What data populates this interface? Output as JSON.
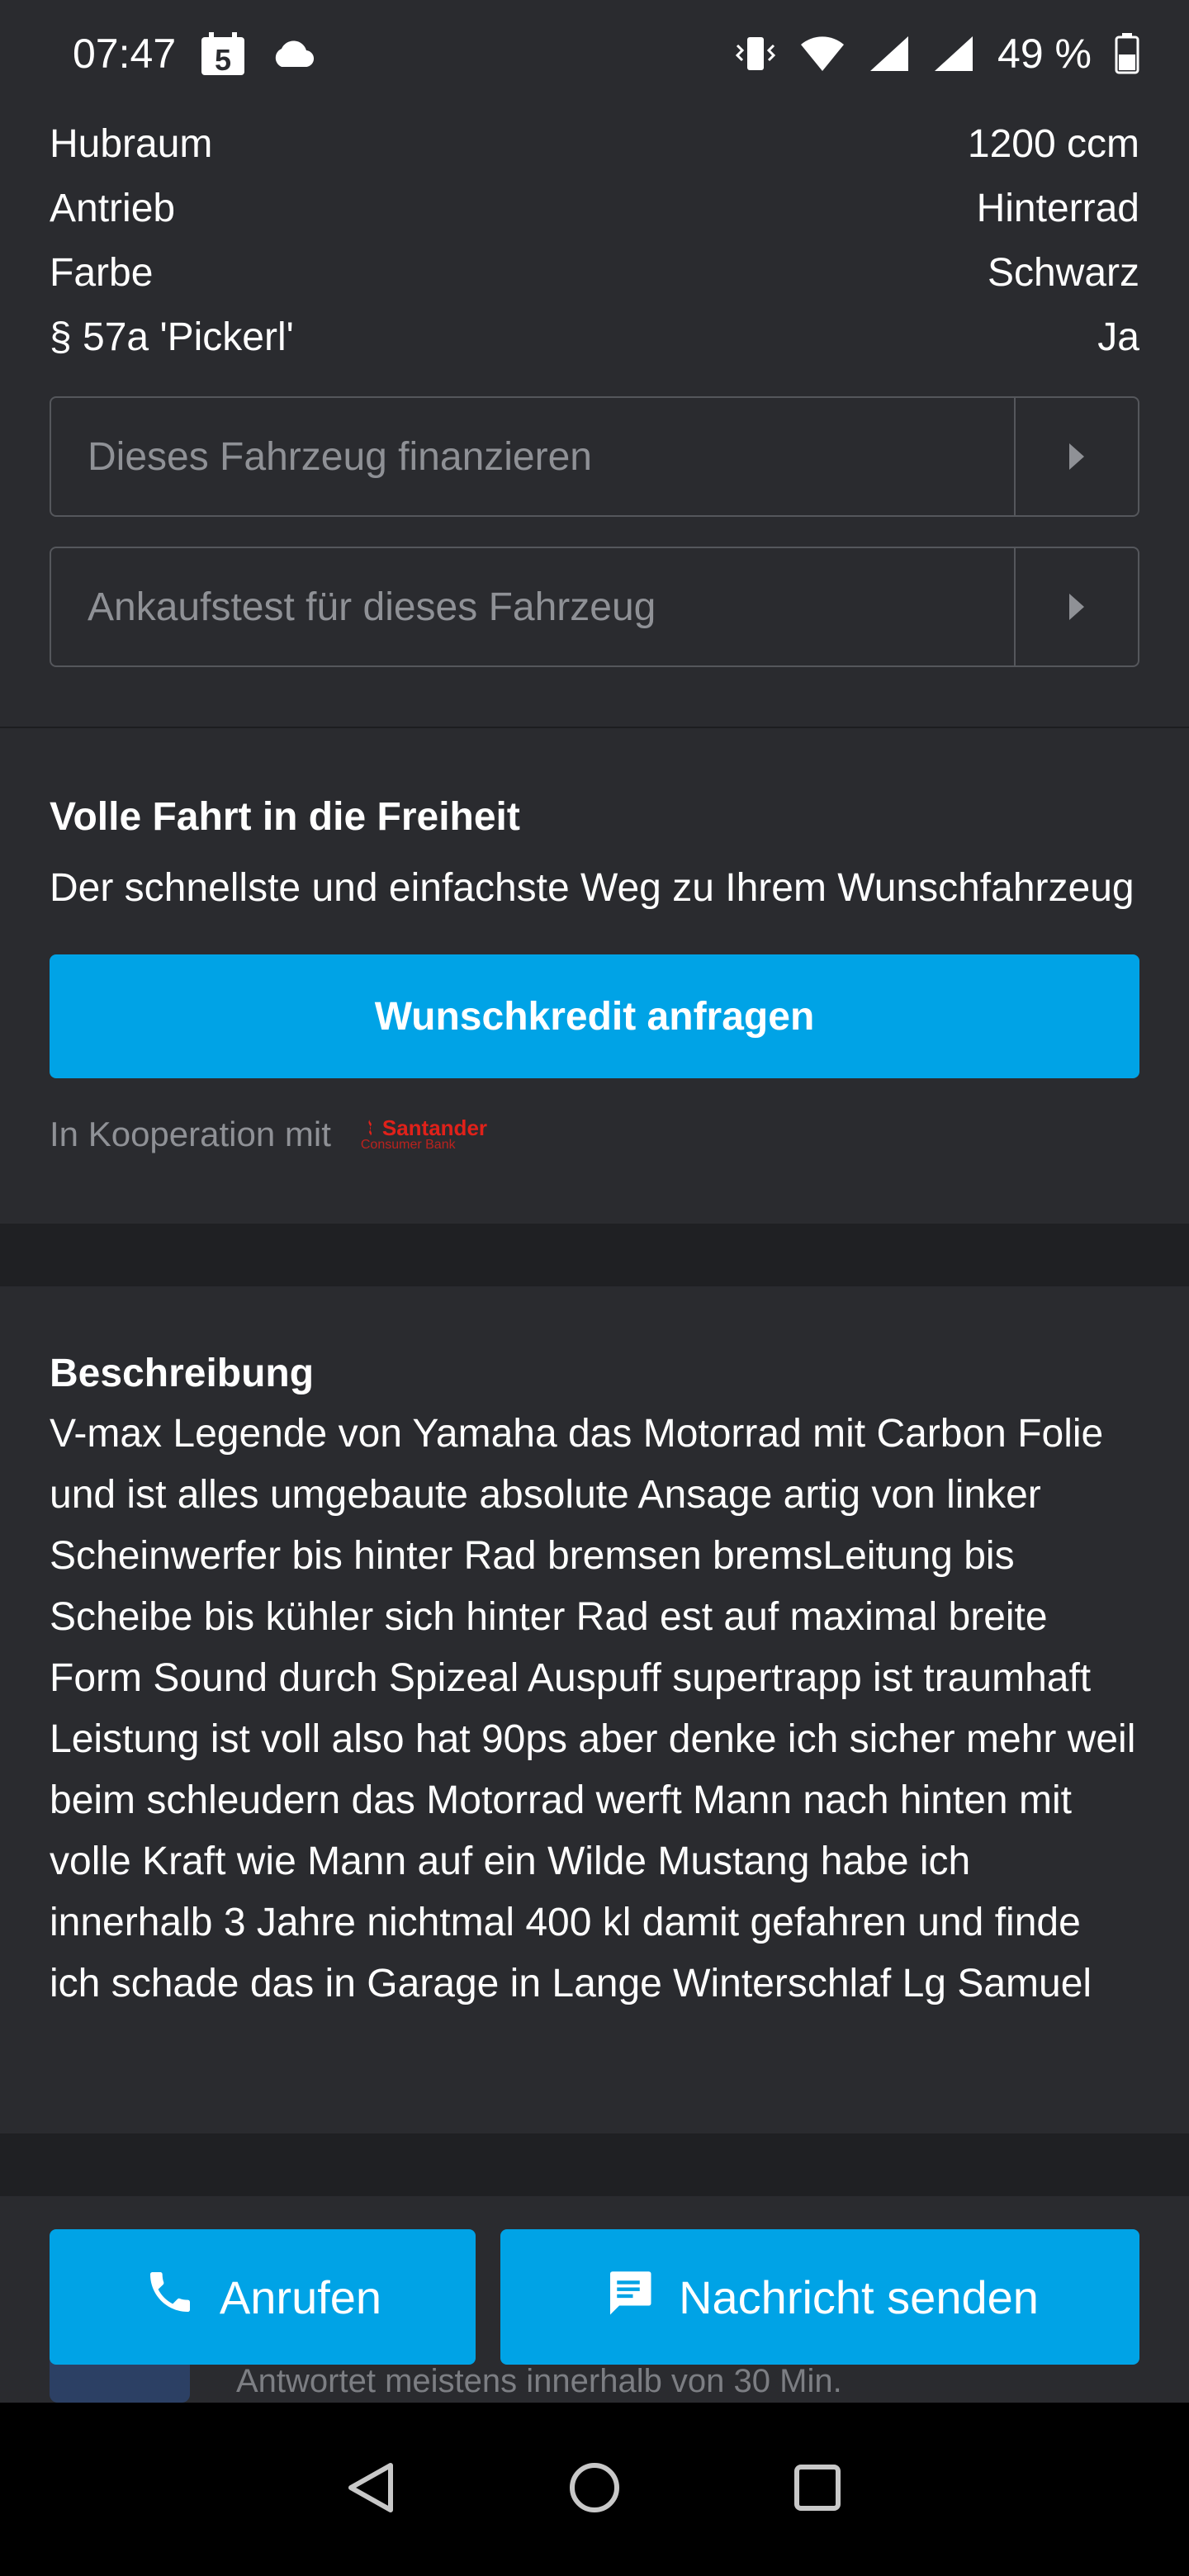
{
  "status_bar": {
    "time": "07:47",
    "calendar_day": "5",
    "battery": "49 %"
  },
  "specs": [
    {
      "label": "Hubraum",
      "value": "1200 ccm"
    },
    {
      "label": "Antrieb",
      "value": "Hinterrad"
    },
    {
      "label": "Farbe",
      "value": "Schwarz"
    },
    {
      "label": "§ 57a 'Pickerl'",
      "value": "Ja"
    }
  ],
  "actions": {
    "finance": "Dieses Fahrzeug finanzieren",
    "inspection": "Ankaufstest für dieses Fahrzeug"
  },
  "promo": {
    "title": "Volle Fahrt in die Freiheit",
    "text": "Der schnellste und einfachste Weg zu Ihrem Wunschfahrzeug",
    "cta": "Wunschkredit anfragen",
    "cooperation": "In Kooperation mit",
    "partner_name": "Santander",
    "partner_sub": "Consumer Bank"
  },
  "description": {
    "title": "Beschreibung",
    "body": "V-max Legende von Yamaha das Motorrad mit Carbon Folie und ist alles umgebaute absolute Ansage artig von linker Scheinwerfer bis hinter Rad bremsen bremsLeitung bis Scheibe bis kühler sich hinter Rad est auf maximal breite Form Sound durch Spizeal Auspuff supertrapp ist traumhaft Leistung ist voll also hat 90ps aber denke ich sicher mehr weil beim schleudern das Motorrad werft Mann nach hinten mit volle Kraft wie Mann auf ein Wilde Mustang habe ich innerhalb 3 Jahre nichtmal 400 kl damit gefahren und finde ich schade das in Garage in Lange Winterschlaf Lg Samuel"
  },
  "seller": {
    "partial": "1",
    "response_time": "Antwortet meistens innerhalb von 30 Min."
  },
  "bottom_actions": {
    "call": "Anrufen",
    "message": "Nachricht senden"
  },
  "colors": {
    "accent": "#00a3e6",
    "background": "#2a2b2f",
    "partner": "#e0211a"
  }
}
